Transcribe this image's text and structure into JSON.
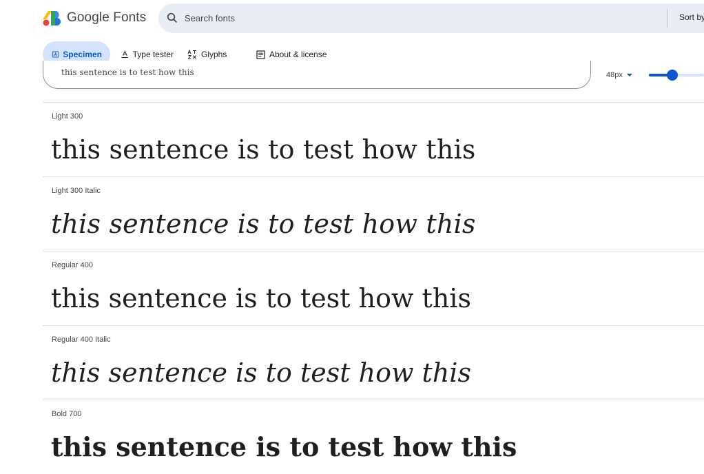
{
  "header": {
    "brand": "Google Fonts",
    "search_placeholder": "Search fonts",
    "sort_label": "Sort by"
  },
  "tabs": [
    {
      "label": "Specimen",
      "active": true,
      "icon": "specimen-icon"
    },
    {
      "label": "Type tester",
      "active": false,
      "icon": "type-tester-icon"
    },
    {
      "label": "Glyphs",
      "active": false,
      "icon": "glyphs-icon"
    },
    {
      "label": "About & license",
      "active": false,
      "icon": "about-icon"
    }
  ],
  "preview": {
    "text": "this sentence is to test how this",
    "size_label": "48px",
    "slider_level": 0.42
  },
  "styles": [
    {
      "label": "Light 300",
      "sample": "this sentence is to test how this"
    },
    {
      "label": "Light 300 Italic",
      "sample": "this sentence is to test how this"
    },
    {
      "label": "Regular 400",
      "sample": "this sentence is to test how this"
    },
    {
      "label": "Regular 400 Italic",
      "sample": "this sentence is to test how this"
    },
    {
      "label": "Bold 700",
      "sample": "this sentence is to test how this"
    }
  ],
  "colors": {
    "accent": "#0b57d0",
    "search_bg": "#e9eef6",
    "active_tab_bg": "#d3e3fd"
  }
}
